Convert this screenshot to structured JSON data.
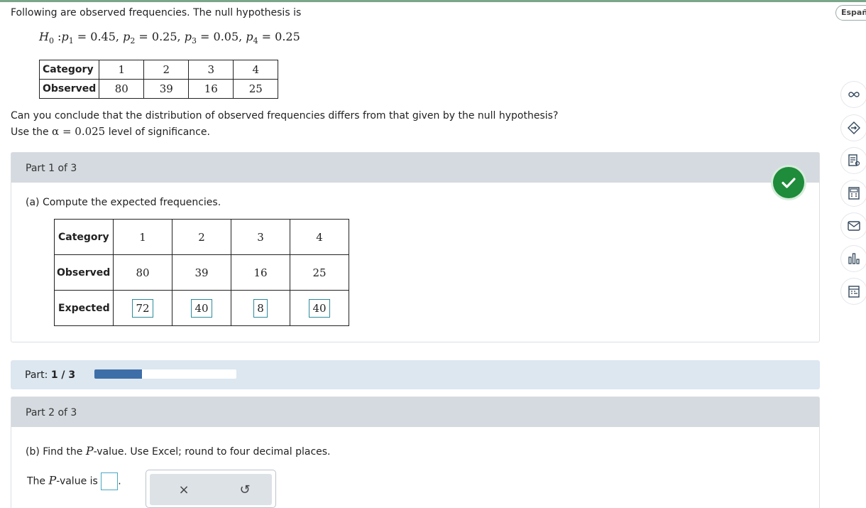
{
  "language_button": "Españo",
  "intro": {
    "text": "Following are observed frequencies. The null hypothesis is",
    "hypothesis": {
      "h0": "H",
      "h0_sub": "0",
      "p1": "p",
      "p1_sub": "1",
      "v1": "0.45",
      "p2": "p",
      "p2_sub": "2",
      "v2": "0.25",
      "p3": "p",
      "p3_sub": "3",
      "v3": "0.05",
      "p4": "p",
      "p4_sub": "4",
      "v4": "0.25"
    },
    "table": {
      "row1_label": "Category",
      "row2_label": "Observed",
      "categories": [
        "1",
        "2",
        "3",
        "4"
      ],
      "observed": [
        "80",
        "39",
        "16",
        "25"
      ]
    },
    "question_line1": "Can you conclude that the distribution of observed frequencies differs from that given by the null hypothesis?",
    "question_line2_pre": "Use the",
    "question_alpha": "α = 0.025",
    "question_line2_post": "level of significance."
  },
  "part1": {
    "header": "Part 1 of 3",
    "prompt": "(a) Compute the expected frequencies.",
    "table": {
      "row1_label": "Category",
      "row2_label": "Observed",
      "row3_label": "Expected",
      "categories": [
        "1",
        "2",
        "3",
        "4"
      ],
      "observed": [
        "80",
        "39",
        "16",
        "25"
      ],
      "expected": [
        "72",
        "40",
        "8",
        "40"
      ]
    },
    "status": "correct"
  },
  "progress": {
    "label": "Part:",
    "value_text": "1 / 3",
    "fraction": 0.333
  },
  "part2": {
    "header": "Part 2 of 3",
    "prompt_pre": "(b) Find the",
    "prompt_p": "P",
    "prompt_post": "-value. Use Excel; round to four decimal places.",
    "answer_pre": "The",
    "answer_p": "P",
    "answer_post": "-value is",
    "answer_value": "",
    "answer_end": ".",
    "tools": {
      "clear": "×",
      "undo": "↺"
    }
  },
  "toolbar_icons": [
    "infinity-icon",
    "tag-icon",
    "notes-icon",
    "calculator-icon",
    "mail-icon",
    "chart-icon",
    "calendar-icon"
  ],
  "colors": {
    "accent": "#3d6ea8",
    "success": "#1e8c3a",
    "panel_header": "#d4dadf",
    "progress_bg": "#dce7f0",
    "input_border": "#2d8a9c"
  }
}
